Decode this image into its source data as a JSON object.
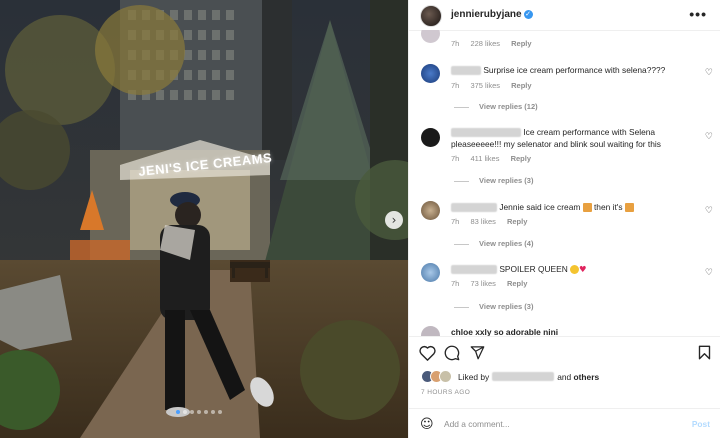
{
  "post": {
    "username": "jennierubyjane",
    "more_label": "•••",
    "photo_sign": "JENI'S ICE CREAMS",
    "carousel": {
      "count": 7,
      "active_index": 0
    }
  },
  "comments": [
    {
      "time": "7h",
      "likes": "228 likes",
      "reply": "Reply"
    },
    {
      "text": " Surprise ice cream performance with selena????",
      "time": "7h",
      "likes": "375 likes",
      "reply": "Reply",
      "view_replies": "View replies (12)"
    },
    {
      "text": " Ice cream performance with Selena pleaseeeee!!! my selenator and blink soul waiting for this",
      "time": "7h",
      "likes": "411 likes",
      "reply": "Reply",
      "view_replies": "View replies (3)"
    },
    {
      "text": " Jennie said ice cream ",
      "text_after": " then it's ",
      "time": "7h",
      "likes": "83 likes",
      "reply": "Reply",
      "view_replies": "View replies (4)"
    },
    {
      "text": " SPOILER QUEEN ",
      "time": "7h",
      "likes": "73 likes",
      "reply": "Reply",
      "view_replies": "View replies (3)"
    },
    {
      "text": "chloe xxly so adorable nini"
    }
  ],
  "actions": {
    "liked_by_prefix": "Liked by",
    "and_label": "and",
    "others_label": "others",
    "timestamp": "7 HOURS AGO"
  },
  "add_comment": {
    "placeholder": "Add a comment...",
    "post_label": "Post"
  },
  "colors": {
    "accent": "#3897f0",
    "post_disabled": "#b3dbff",
    "meta_gray": "#8e8e8e"
  }
}
